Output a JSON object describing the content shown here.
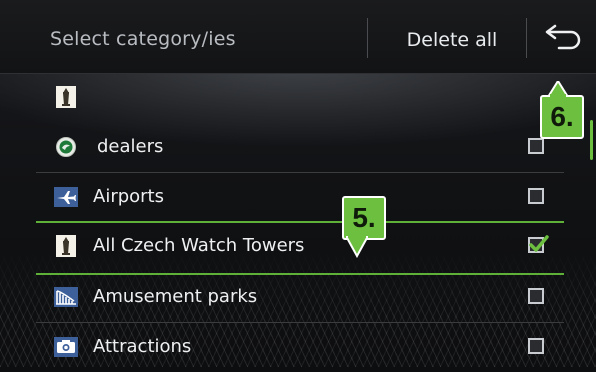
{
  "header": {
    "title": "Select category/ies",
    "delete_all_label": "Delete all"
  },
  "list": {
    "rows": [
      {
        "label": "",
        "icon": "tower-icon",
        "checked": null
      },
      {
        "label": "dealers",
        "icon": "brand-logo-icon",
        "checked": false
      },
      {
        "label": "Airports",
        "icon": "airplane-icon",
        "checked": false
      },
      {
        "label": "All Czech Watch Towers",
        "icon": "tower-icon",
        "checked": true
      },
      {
        "label": "Amusement parks",
        "icon": "amusement-park-icon",
        "checked": false
      },
      {
        "label": "Attractions",
        "icon": "camera-icon",
        "checked": false
      }
    ]
  },
  "callouts": {
    "list_marker": "5.",
    "back_marker": "6."
  },
  "colors": {
    "accent": "#6cbf3f",
    "background": "#0d0e10",
    "text": "#eef0f2",
    "header_text": "#b9bdc2"
  }
}
